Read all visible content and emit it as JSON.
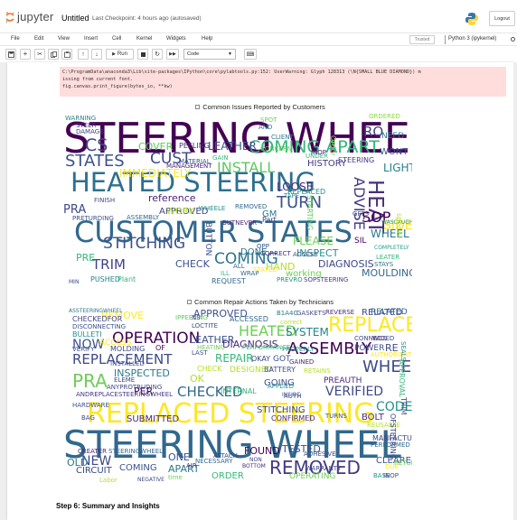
{
  "header": {
    "logo_text": "jupyter",
    "notebook_title": "Untitled",
    "checkpoint": "Last Checkpoint: 4 hours ago  (autosaved)",
    "logout_label": "Logout"
  },
  "menu": {
    "items": [
      "File",
      "Edit",
      "View",
      "Insert",
      "Cell",
      "Kernel",
      "Widgets",
      "Help"
    ],
    "trusted_label": "Trusted",
    "kernel_label": "Python 3 (ipykernel)"
  },
  "toolbar": {
    "run_label": "Run",
    "cell_type": "Code"
  },
  "output": {
    "warning_lines": [
      "C:\\ProgramData\\anaconda3\\Lib\\site-packages\\IPython\\core\\pylabtools.py:152: UserWarning: Glyph 128313 (\\N{SMALL BLUE DIAMOND}) m",
      "issing from current font.",
      "  fig.canvas.print_figure(bytes_io, **kw)"
    ],
    "cloud1_title": "Common Issues Reported by Customers",
    "cloud2_title": "Common Repair Actions Taken by Technicians"
  },
  "cloud1_words": [
    {
      "t": "STEERING WHEEL",
      "c": "#440154"
    },
    {
      "t": "HEATED STEERING",
      "c": "#2d708e"
    },
    {
      "t": "CUSTOMER STATES",
      "c": "#31688e"
    },
    {
      "t": "COMING APART",
      "c": "#35b779"
    },
    {
      "t": "STATES",
      "c": "#3b528b"
    },
    {
      "t": "INSTALL",
      "c": "#5ec962"
    },
    {
      "t": "STITCHING",
      "c": "#3b528b"
    },
    {
      "t": "COMING",
      "c": "#2c728e"
    },
    {
      "t": "TRIM",
      "c": "#414487"
    },
    {
      "t": "HEAT",
      "c": "#472d7b"
    },
    {
      "t": "ADVISE",
      "c": "#443983"
    },
    {
      "t": "SOP",
      "c": "#440154"
    },
    {
      "t": "TURN",
      "c": "#3b528b"
    },
    {
      "t": "CUST",
      "c": "#3e4989"
    },
    {
      "t": "LEATHER",
      "c": "#3b528b"
    },
    {
      "t": "LOOSE",
      "c": "#482878"
    },
    {
      "t": "PLEASE",
      "c": "#6ece58"
    },
    {
      "t": "INSPECT",
      "c": "#21918c"
    },
    {
      "t": "DIAGNOSIS",
      "c": "#3e4989"
    },
    {
      "t": "MOULDING",
      "c": "#31688e"
    },
    {
      "t": "WHEEL",
      "c": "#2a788e"
    },
    {
      "t": "SIDE",
      "c": "#fde725"
    },
    {
      "t": "LIGHT",
      "c": "#26828e"
    },
    {
      "t": "HISTORY",
      "c": "#443983"
    },
    {
      "t": "CHECK",
      "c": "#3b528b"
    },
    {
      "t": "HAND",
      "c": "#b5de2b"
    },
    {
      "t": "working",
      "c": "#6ece58"
    },
    {
      "t": "reference",
      "c": "#482475"
    },
    {
      "t": "APPROVED",
      "c": "#414487"
    },
    {
      "t": "PRA",
      "c": "#3e4989"
    },
    {
      "t": "PRE",
      "c": "#35b779"
    },
    {
      "t": "RO",
      "c": "#414487"
    },
    {
      "t": "NEED",
      "c": "#2a788e"
    },
    {
      "t": "IMMEDIATELY",
      "c": "#fde725"
    },
    {
      "t": "COVER",
      "c": "#5ec962"
    },
    {
      "t": "AUTHORIZATION",
      "c": "#5ec962"
    },
    {
      "t": "GM",
      "c": "#2a788e"
    },
    {
      "t": "BUTTON",
      "c": "#3b528b"
    },
    {
      "t": "CS",
      "c": "#414487"
    },
    {
      "t": "REQUEST",
      "c": "#31688e"
    },
    {
      "t": "STEERING",
      "c": "#443983"
    },
    {
      "t": "WORK",
      "c": "#b5de2b"
    },
    {
      "t": "DONE",
      "c": "#2a788e"
    },
    {
      "t": "PUSHED",
      "c": "#26828e"
    },
    {
      "t": "Plant",
      "c": "#35b779"
    },
    {
      "t": "SPOT",
      "c": "#6ece58"
    },
    {
      "t": "WHEELE",
      "c": "#21918c"
    },
    {
      "t": "ORDERED",
      "c": "#90d743"
    },
    {
      "t": "CLIENT",
      "c": "#2a788e"
    },
    {
      "t": "PEELING",
      "c": "#472d7b"
    },
    {
      "t": "MANAGEMENT",
      "c": "#482878"
    },
    {
      "t": "FINISH",
      "c": "#3e4989"
    },
    {
      "t": "ASSEMBLY",
      "c": "#31688e"
    },
    {
      "t": "PRETURDING",
      "c": "#3b528b"
    },
    {
      "t": "REPLACED",
      "c": "#21918c"
    },
    {
      "t": "GAIN",
      "c": "#35b779"
    },
    {
      "t": "STEER",
      "c": "#482878"
    },
    {
      "t": "DAMAGE",
      "c": "#3e4989"
    },
    {
      "t": "WARNING",
      "c": "#26828e"
    },
    {
      "t": "COMPLETELY",
      "c": "#1f9e89"
    },
    {
      "t": "LEATER",
      "c": "#35b779"
    },
    {
      "t": "STAYS",
      "c": "#2a788e"
    },
    {
      "t": "WRAP",
      "c": "#31688e"
    },
    {
      "t": "CORRECT",
      "c": "#472d7b"
    },
    {
      "t": "ACCESS",
      "c": "#3b528b"
    },
    {
      "t": "PREVRO",
      "c": "#21918c"
    },
    {
      "t": "SOPSTEERING",
      "c": "#443983"
    },
    {
      "t": "MIN",
      "c": "#3e4989"
    },
    {
      "t": "STATED",
      "c": "#fde725"
    },
    {
      "t": "CONCERN",
      "c": "#5ec962"
    },
    {
      "t": "BUTNEVER",
      "c": "#482878"
    },
    {
      "t": "MATERIAL",
      "c": "#3b528b"
    },
    {
      "t": "UNDER",
      "c": "#35b779"
    },
    {
      "t": "REMOVED",
      "c": "#31688e"
    },
    {
      "t": "GFTS",
      "c": "#3e4989"
    },
    {
      "t": "WASCAUGHT",
      "c": "#21918c"
    },
    {
      "t": "special",
      "c": "#b5de2b"
    },
    {
      "t": "Order",
      "c": "#90d743"
    },
    {
      "t": "WONT",
      "c": "#3b528b"
    },
    {
      "t": "AND",
      "c": "#2a788e"
    },
    {
      "t": "INOP",
      "c": "#482475"
    },
    {
      "t": "STARTING",
      "c": "#5ec962"
    },
    {
      "t": "SIL",
      "c": "#440154"
    },
    {
      "t": "Part",
      "c": "#443983"
    },
    {
      "t": "ALL",
      "c": "#31688e"
    },
    {
      "t": "OPP",
      "c": "#3b528b"
    },
    {
      "t": "ILL",
      "c": "#35b779"
    },
    {
      "t": "TAPE",
      "c": "#21918c"
    }
  ],
  "cloud2_words": [
    {
      "t": "STEERING WHEEL",
      "c": "#31688e"
    },
    {
      "t": "REPLACED STEERING",
      "c": "#fde725"
    },
    {
      "t": "REPLACE",
      "c": "#fde725"
    },
    {
      "t": "OPERATION",
      "c": "#440154"
    },
    {
      "t": "ASSEMBLY",
      "c": "#440154"
    },
    {
      "t": "REPLACEMENT",
      "c": "#3e4989"
    },
    {
      "t": "WHEEL",
      "c": "#3e4989"
    },
    {
      "t": "CHECKED",
      "c": "#31688e"
    },
    {
      "t": "VERIFIED",
      "c": "#3e4989"
    },
    {
      "t": "REMOVED",
      "c": "#443983"
    },
    {
      "t": "CODE",
      "c": "#21918c"
    },
    {
      "t": "PRA",
      "c": "#6ece58"
    },
    {
      "t": "NOW",
      "c": "#3b528b"
    },
    {
      "t": "PER",
      "c": "#440154"
    },
    {
      "t": "NEW",
      "c": "#3e4989"
    },
    {
      "t": "HEATED",
      "c": "#6ece58"
    },
    {
      "t": "SYSTEM",
      "c": "#26828e"
    },
    {
      "t": "LEATHER",
      "c": "#3b528b"
    },
    {
      "t": "DIAGNOSIS",
      "c": "#482878"
    },
    {
      "t": "INSPECTED",
      "c": "#2a788e"
    },
    {
      "t": "REPAIR",
      "c": "#35b779"
    },
    {
      "t": "OK",
      "c": "#b5de2b"
    },
    {
      "t": "SUBMITTED",
      "c": "#482878"
    },
    {
      "t": "COMING",
      "c": "#3b528b"
    },
    {
      "t": "APART",
      "c": "#2a788e"
    },
    {
      "t": "FOUND",
      "c": "#440154"
    },
    {
      "t": "TESTED",
      "c": "#3e4989"
    },
    {
      "t": "CLEARED",
      "c": "#3b528b"
    },
    {
      "t": "BOLT",
      "c": "#472d7b"
    },
    {
      "t": "CIRCUIT",
      "c": "#3e4989"
    },
    {
      "t": "ORDER",
      "c": "#35b779"
    },
    {
      "t": "OPERATING",
      "c": "#6ece58"
    },
    {
      "t": "REMOVE",
      "c": "#fde725"
    },
    {
      "t": "APPROVED",
      "c": "#3b528b"
    },
    {
      "t": "RELATED",
      "c": "#3e4989"
    },
    {
      "t": "ACCESSED",
      "c": "#31688e"
    },
    {
      "t": "GASKETS",
      "c": "#3e4989"
    },
    {
      "t": "REVERSE",
      "c": "#482878"
    },
    {
      "t": "CHECKEDFOR",
      "c": "#414487"
    },
    {
      "t": "DISCONNECTING",
      "c": "#3b528b"
    },
    {
      "t": "BULLETI",
      "c": "#21918c"
    },
    {
      "t": "ASSTEERINGWHEEL",
      "c": "#2a788e"
    },
    {
      "t": "AUTHORIZATION",
      "c": "#fde725"
    },
    {
      "t": "POWER",
      "c": "#3b528b"
    },
    {
      "t": "RE",
      "c": "#3e4989"
    },
    {
      "t": "SEALS",
      "c": "#26828e"
    },
    {
      "t": "RETAINS",
      "c": "#b5de2b"
    },
    {
      "t": "PREAUTH",
      "c": "#482878"
    },
    {
      "t": "RELATED",
      "c": "#31688e"
    },
    {
      "t": "REUSABLE",
      "c": "#b5de2b"
    },
    {
      "t": "TURNS",
      "c": "#3b528b"
    },
    {
      "t": "CONFIRMED",
      "c": "#482878"
    },
    {
      "t": "INTERNAL",
      "c": "#35b779"
    },
    {
      "t": "APPLIED",
      "c": "#21918c"
    },
    {
      "t": "ANYPROTRUDING",
      "c": "#3e4989"
    },
    {
      "t": "ANDREPLACESTEERINGWHEEL",
      "c": "#443983"
    },
    {
      "t": "HARDWARE",
      "c": "#3b528b"
    },
    {
      "t": "BAG",
      "c": "#3e4989"
    },
    {
      "t": "CREATER",
      "c": "#482878"
    },
    {
      "t": "STEERINGWHEEL",
      "c": "#31688e"
    },
    {
      "t": "OLD",
      "c": "#2a788e"
    },
    {
      "t": "ONE",
      "c": "#3b528b"
    },
    {
      "t": "AIR",
      "c": "#482878"
    },
    {
      "t": "NECESSARY",
      "c": "#31688e"
    },
    {
      "t": "ATTACH",
      "c": "#3e4989"
    },
    {
      "t": "ADHESIVE",
      "c": "#3b528b"
    },
    {
      "t": "WARRANTY",
      "c": "#3e4989"
    },
    {
      "t": "PERFORMED",
      "c": "#31688e"
    },
    {
      "t": "MANFACTURER",
      "c": "#3e4989"
    },
    {
      "t": "BASE",
      "c": "#21918c"
    },
    {
      "t": "INOP",
      "c": "#3b528b"
    },
    {
      "t": "DUE",
      "c": "#fde725"
    },
    {
      "t": "Labor",
      "c": "#b5de2b"
    },
    {
      "t": "NEGATIVE",
      "c": "#3e4989"
    },
    {
      "t": "time",
      "c": "#6ece58"
    },
    {
      "t": "BOTTOM",
      "c": "#482878"
    },
    {
      "t": "NON",
      "c": "#443983"
    },
    {
      "t": "GOING",
      "c": "#3b528b"
    },
    {
      "t": "DESIGNED",
      "c": "#b5de2b"
    },
    {
      "t": "OKAY",
      "c": "#3e4989"
    },
    {
      "t": "GOT",
      "c": "#3b528b"
    },
    {
      "t": "BATTERY",
      "c": "#3b528b"
    },
    {
      "t": "CHECK",
      "c": "#b5de2b"
    },
    {
      "t": "WILL",
      "c": "#440154"
    },
    {
      "t": "CONNECTED",
      "c": "#3e4989"
    },
    {
      "t": "INSIDE",
      "c": "#3b528b"
    },
    {
      "t": "PERFORMANCE",
      "c": "#35b779"
    },
    {
      "t": "HEATING",
      "c": "#6ece58"
    },
    {
      "t": "LOCTITE",
      "c": "#3b528b"
    },
    {
      "t": "MOLDING",
      "c": "#3e4989"
    },
    {
      "t": "ACCESS",
      "c": "#fde725"
    },
    {
      "t": "OF",
      "c": "#440154"
    },
    {
      "t": "LAST",
      "c": "#3b528b"
    },
    {
      "t": "APPROVAL",
      "c": "#35b779"
    },
    {
      "t": "STITCHING",
      "c": "#3e4989"
    },
    {
      "t": "INSTALLED",
      "c": "#3b528b"
    },
    {
      "t": "ELEME",
      "c": "#3e4989"
    },
    {
      "t": "AUTH",
      "c": "#3e4989"
    },
    {
      "t": "correct",
      "c": "#b5de2b"
    },
    {
      "t": "IPPEELING",
      "c": "#5ec962"
    },
    {
      "t": "NS",
      "c": "#3e4989"
    },
    {
      "t": "B1A4C",
      "c": "#2a788e"
    },
    {
      "t": "GAINED",
      "c": "#482878"
    },
    {
      "t": "VERIFY",
      "c": "#3b528b"
    },
    {
      "t": "OFSTEERING",
      "c": "#3e4989"
    },
    {
      "t": "RETURN",
      "c": "#6ece58"
    },
    {
      "t": "TRIM",
      "c": "#3b528b"
    },
    {
      "t": "PROPERLY",
      "c": "#21918c"
    },
    {
      "t": "WITH",
      "c": "#3e4989"
    }
  ],
  "step_heading": "Step 6: Summary and Insights"
}
